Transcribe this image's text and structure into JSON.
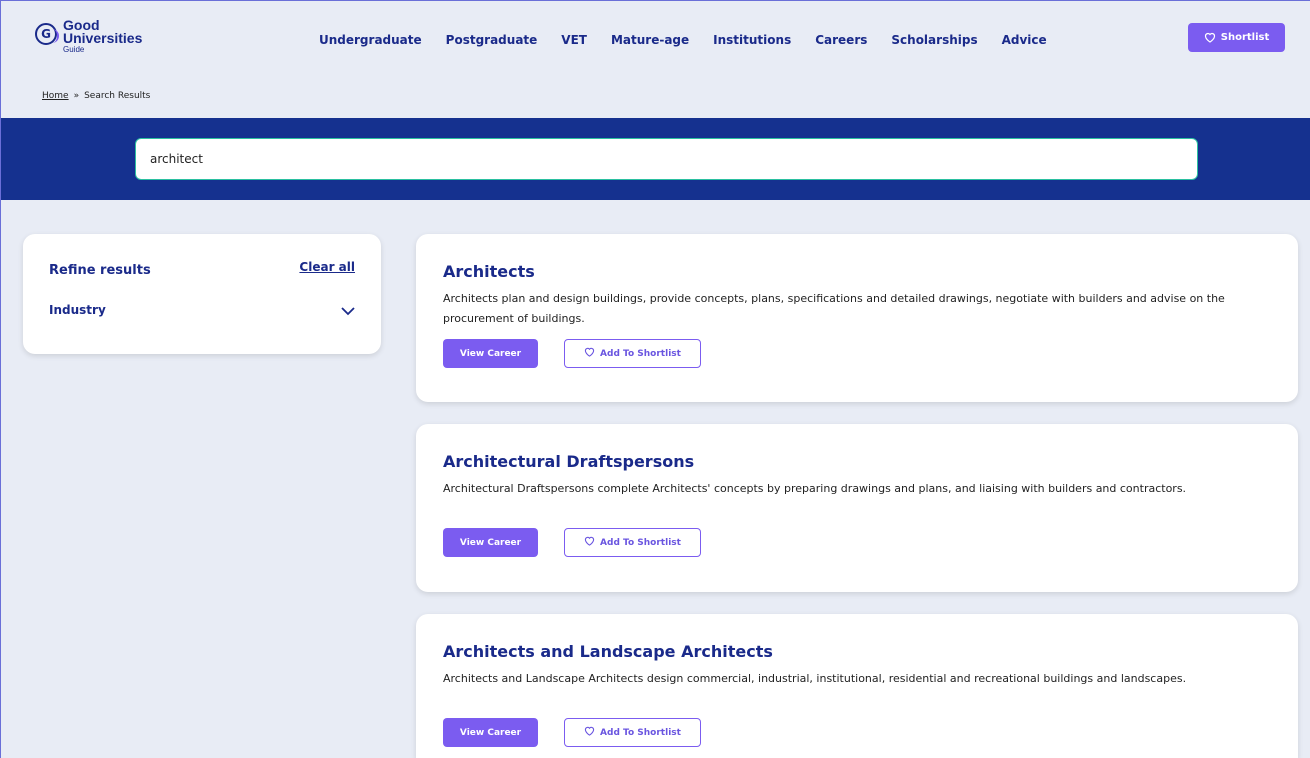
{
  "header": {
    "logo": {
      "line1": "Good",
      "line2": "Universities",
      "sub": "Guide",
      "mark": "G"
    },
    "nav": [
      "Undergraduate",
      "Postgraduate",
      "VET",
      "Mature-age",
      "Institutions",
      "Careers",
      "Scholarships",
      "Advice"
    ],
    "shortlist_label": "Shortlist"
  },
  "breadcrumb": {
    "home": "Home",
    "separator": "»",
    "current": "Search Results"
  },
  "search": {
    "value": "architect"
  },
  "sidebar": {
    "title": "Refine results",
    "clear_label": "Clear all",
    "filters": [
      {
        "label": "Industry"
      }
    ]
  },
  "results": [
    {
      "title": "Architects",
      "description": "Architects plan and design buildings, provide concepts, plans, specifications and detailed drawings, negotiate with builders and advise on the procurement of buildings.",
      "view_label": "View Career",
      "add_label": "Add To Shortlist"
    },
    {
      "title": "Architectural Draftspersons",
      "description": "Architectural Draftspersons complete Architects' concepts by preparing drawings and plans, and liaising with builders and contractors.",
      "view_label": "View Career",
      "add_label": "Add To Shortlist"
    },
    {
      "title": "Architects and Landscape Architects",
      "description": "Architects and Landscape Architects design commercial, industrial, institutional, residential and recreational buildings and landscapes.",
      "view_label": "View Career",
      "add_label": "Add To Shortlist"
    }
  ],
  "colors": {
    "brand": "#1a2a8a",
    "accent": "#7b5cf0",
    "band": "#15318f",
    "background": "#e8ecf5"
  }
}
